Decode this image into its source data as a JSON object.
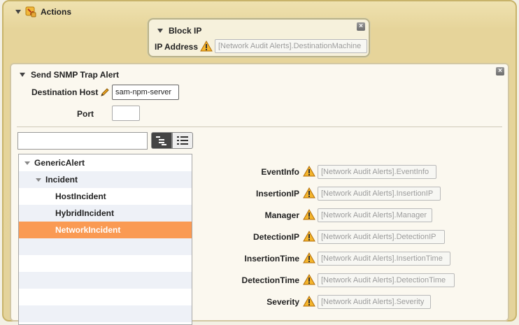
{
  "actions": {
    "title": "Actions",
    "icon": "actions-icon"
  },
  "block_ip": {
    "title": "Block IP",
    "ip_label": "IP Address",
    "ip_value": "[Network Audit Alerts].DestinationMachine",
    "close": "×"
  },
  "snmp": {
    "title": "Send SNMP Trap Alert",
    "close": "×",
    "destination_label": "Destination Host",
    "destination_value": "sam-npm-server",
    "port_label": "Port",
    "port_value": "",
    "search_value": ""
  },
  "tree": [
    {
      "label": "GenericAlert",
      "level": 0,
      "expanded": true,
      "selected": false
    },
    {
      "label": "Incident",
      "level": 1,
      "expanded": true,
      "selected": false
    },
    {
      "label": "HostIncident",
      "level": 2,
      "expanded": false,
      "selected": false
    },
    {
      "label": "HybridIncident",
      "level": 2,
      "expanded": false,
      "selected": false
    },
    {
      "label": "NetworkIncident",
      "level": 2,
      "expanded": false,
      "selected": true
    },
    {
      "label": "",
      "level": 0
    },
    {
      "label": "",
      "level": 0
    },
    {
      "label": "",
      "level": 0
    },
    {
      "label": "",
      "level": 0
    },
    {
      "label": "",
      "level": 0
    }
  ],
  "properties": [
    {
      "label": "EventInfo",
      "value": "[Network Audit Alerts].EventInfo"
    },
    {
      "label": "InsertionIP",
      "value": "[Network Audit Alerts].InsertionIP"
    },
    {
      "label": "Manager",
      "value": "[Network Audit Alerts].Manager"
    },
    {
      "label": "DetectionIP",
      "value": "[Network Audit Alerts].DetectionIP"
    },
    {
      "label": "InsertionTime",
      "value": "[Network Audit Alerts].InsertionTime"
    },
    {
      "label": "DetectionTime",
      "value": "[Network Audit Alerts].DetectionTime"
    },
    {
      "label": "Severity",
      "value": "[Network Audit Alerts].Severity"
    }
  ],
  "colors": {
    "selected": "#fa9a53",
    "warning": "#f0a020",
    "panel": "#fbf8ef",
    "frame": "#c8b36a"
  }
}
